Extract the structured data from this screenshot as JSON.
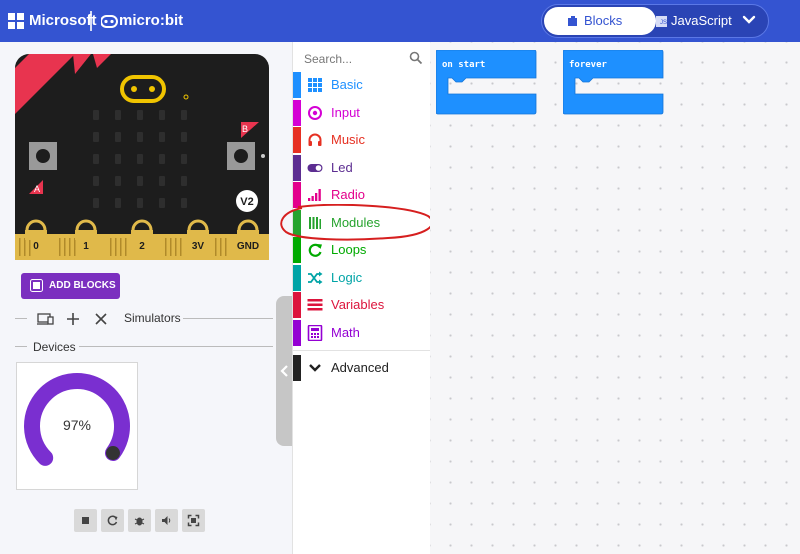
{
  "header": {
    "brand": "Microsoft",
    "product": "micro:bit",
    "editor_toggle": {
      "blocks_label": "Blocks",
      "javascript_label": "JavaScript",
      "js_badge": "JS"
    }
  },
  "simulator": {
    "board": {
      "pins": [
        "0",
        "1",
        "2",
        "3V",
        "GND"
      ],
      "button_a": "A",
      "button_b": "B",
      "version_badge": "V2"
    },
    "add_blocks_label": "ADD BLOCKS",
    "simulators_label": "Simulators",
    "devices_label": "Devices",
    "gauge": {
      "value": 97,
      "label": "97%",
      "color": "#7a2fd0"
    },
    "controls": [
      "stop-icon",
      "restart-icon",
      "debug-icon",
      "mute-icon",
      "fullscreen-icon"
    ]
  },
  "toolbox": {
    "search_placeholder": "Search...",
    "categories": [
      {
        "label": "Basic",
        "color": "#1E90FF",
        "icon": "grid-icon"
      },
      {
        "label": "Input",
        "color": "#D400D4",
        "icon": "target-icon"
      },
      {
        "label": "Music",
        "color": "#E63022",
        "icon": "headphones-icon"
      },
      {
        "label": "Led",
        "color": "#5C2D91",
        "icon": "toggle-icon"
      },
      {
        "label": "Radio",
        "color": "#E3008C",
        "icon": "signal-bars-icon"
      },
      {
        "label": "Modules",
        "color": "#26A32E",
        "icon": "modules-icon"
      },
      {
        "label": "Loops",
        "color": "#00AA00",
        "icon": "refresh-icon"
      },
      {
        "label": "Logic",
        "color": "#00A4A6",
        "icon": "shuffle-icon"
      },
      {
        "label": "Variables",
        "color": "#DC143C",
        "icon": "lines-icon"
      },
      {
        "label": "Math",
        "color": "#9400D3",
        "icon": "calculator-icon"
      }
    ],
    "advanced_label": "Advanced"
  },
  "workspace": {
    "blocks": [
      {
        "label": "on start",
        "color": "#1E90FF"
      },
      {
        "label": "forever",
        "color": "#1E90FF"
      }
    ]
  }
}
